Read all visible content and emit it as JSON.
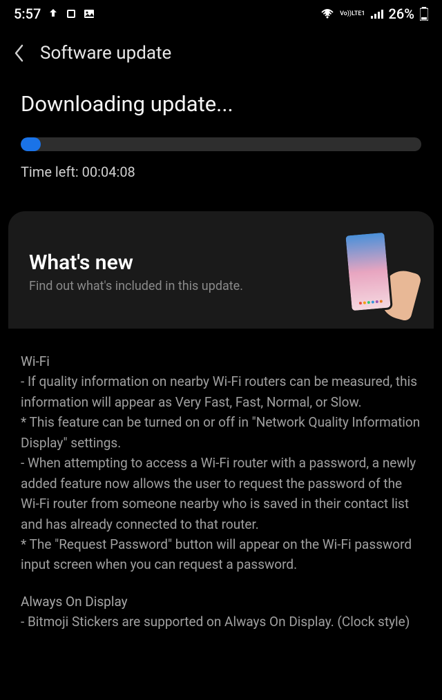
{
  "statusBar": {
    "time": "5:57",
    "lteLabel": "LTE1",
    "voLabel": "Vo))",
    "battery": "26%"
  },
  "header": {
    "title": "Software update"
  },
  "download": {
    "title": "Downloading update...",
    "progressPercent": 5,
    "timeLeftLabel": "Time left: 00:04:08"
  },
  "whatsNew": {
    "title": "What's new",
    "subtitle": "Find out what's included in this update."
  },
  "changelog": {
    "sections": [
      {
        "heading": "Wi-Fi",
        "lines": [
          " - If quality information on nearby Wi-Fi routers can be measured, this information will appear as   Very Fast, Fast, Normal, or Slow.",
          "  * This feature can be turned on or off in \"Network Quality Information Display\" settings.",
          " - When attempting to access a Wi-Fi router with a password, a newly added feature now allows the user to request the password of the Wi-Fi router from someone nearby who is saved in their contact list and has already connected to that router.",
          "  * The \"Request Password\" button will appear on the Wi-Fi password input screen when you can request a password."
        ]
      },
      {
        "heading": "Always On Display",
        "lines": [
          " - Bitmoji Stickers are supported on Always On Display. (Clock style)"
        ]
      }
    ]
  }
}
